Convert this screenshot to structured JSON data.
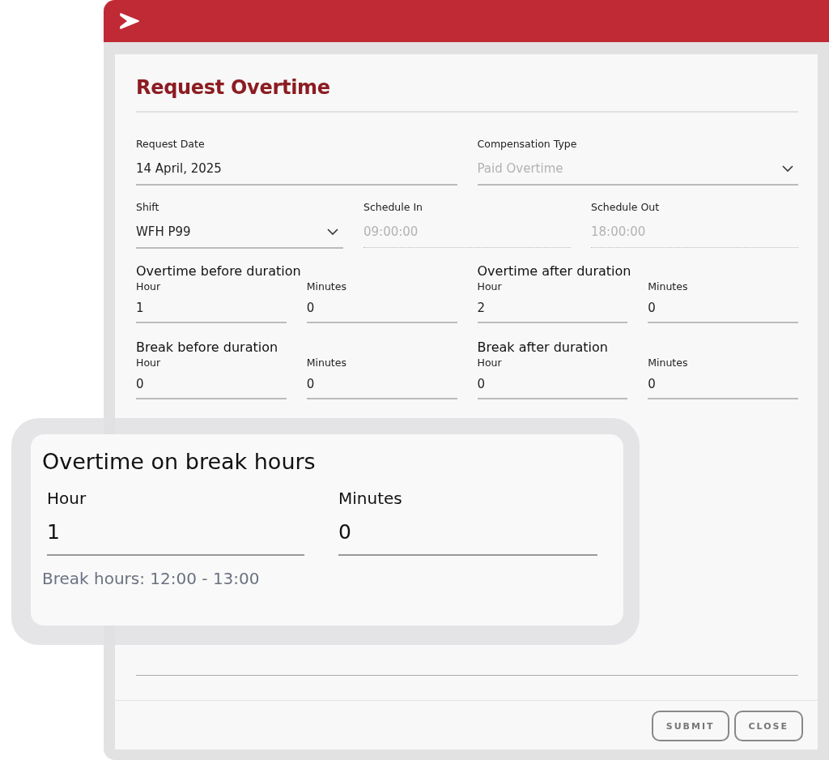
{
  "dialog": {
    "title": "Request Overtime"
  },
  "field_rows": [
    [
      {
        "label": "Request Date",
        "value": "14 April, 2025",
        "kind": "text",
        "disabled": false
      },
      {
        "label": "Compensation Type",
        "value": "Paid Overtime",
        "kind": "select",
        "disabled": true
      }
    ],
    [
      {
        "label": "Shift",
        "value": "WFH P99",
        "kind": "select",
        "disabled": false
      },
      {
        "label": "Schedule In",
        "value": "09:00:00",
        "kind": "text",
        "disabled": true
      },
      {
        "label": "Schedule Out",
        "value": "18:00:00",
        "kind": "text",
        "disabled": true
      }
    ]
  ],
  "duration_rows": [
    [
      {
        "title": "Overtime before duration",
        "fields": [
          {
            "label": "Hour",
            "value": "1"
          },
          {
            "label": "Minutes",
            "value": "0"
          }
        ]
      },
      {
        "title": "Overtime after duration",
        "fields": [
          {
            "label": "Hour",
            "value": "2"
          },
          {
            "label": "Minutes",
            "value": "0"
          }
        ]
      }
    ],
    [
      {
        "title": "Break before duration",
        "fields": [
          {
            "label": "Hour",
            "value": "0"
          },
          {
            "label": "Minutes",
            "value": "0"
          }
        ]
      },
      {
        "title": "Break after duration",
        "fields": [
          {
            "label": "Hour",
            "value": "0"
          },
          {
            "label": "Minutes",
            "value": "0"
          }
        ]
      }
    ]
  ],
  "callout": {
    "title": "Overtime on break hours",
    "fields": [
      {
        "label": "Hour",
        "value": "1"
      },
      {
        "label": "Minutes",
        "value": "0"
      }
    ],
    "note": "Break hours: 12:00 - 13:00"
  },
  "buttons": [
    "SUBMIT",
    "CLOSE"
  ]
}
